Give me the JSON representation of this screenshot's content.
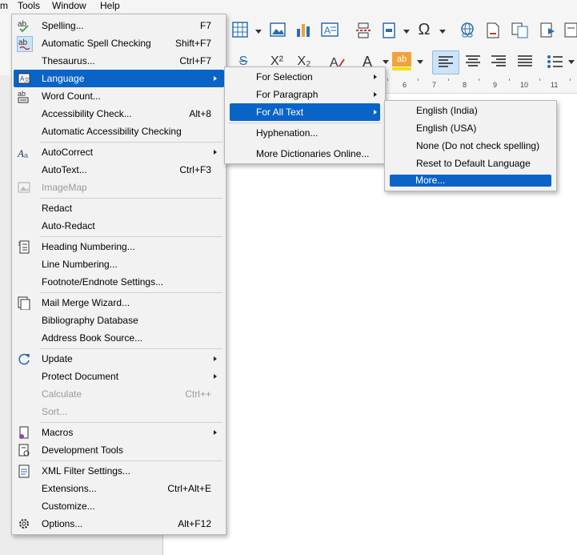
{
  "menubar": {
    "partial_item": "m",
    "tools": "Tools",
    "window": "Window",
    "help": "Help"
  },
  "ruler": {
    "ticks": [
      "6",
      "7",
      "8",
      "9",
      "10",
      "11"
    ]
  },
  "toolbar": {
    "superscript_glyph": "X²",
    "subscript_glyph": "X₂",
    "font_color_glyph": "A",
    "highlight_glyph": "ab",
    "special_char_glyph": "Ω",
    "strikethrough_glyph": "S"
  },
  "tools_menu": {
    "items": [
      {
        "label": "Spelling...",
        "shortcut": "F7"
      },
      {
        "label": "Automatic Spell Checking",
        "shortcut": "Shift+F7"
      },
      {
        "label": "Thesaurus...",
        "shortcut": "Ctrl+F7"
      },
      {
        "label": "Language"
      },
      {
        "label": "Word Count..."
      },
      {
        "label": "Accessibility Check...",
        "shortcut": "Alt+8"
      },
      {
        "label": "Automatic Accessibility Checking"
      },
      {
        "label": "AutoCorrect"
      },
      {
        "label": "AutoText...",
        "shortcut": "Ctrl+F3"
      },
      {
        "label": "ImageMap"
      },
      {
        "label": "Redact"
      },
      {
        "label": "Auto-Redact"
      },
      {
        "label": "Heading Numbering..."
      },
      {
        "label": "Line Numbering..."
      },
      {
        "label": "Footnote/Endnote Settings..."
      },
      {
        "label": "Mail Merge Wizard..."
      },
      {
        "label": "Bibliography Database"
      },
      {
        "label": "Address Book Source..."
      },
      {
        "label": "Update"
      },
      {
        "label": "Protect Document"
      },
      {
        "label": "Calculate",
        "shortcut": "Ctrl++"
      },
      {
        "label": "Sort..."
      },
      {
        "label": "Macros"
      },
      {
        "label": "Development Tools"
      },
      {
        "label": "XML Filter Settings..."
      },
      {
        "label": "Extensions...",
        "shortcut": "Ctrl+Alt+E"
      },
      {
        "label": "Customize..."
      },
      {
        "label": "Options...",
        "shortcut": "Alt+F12"
      }
    ]
  },
  "language_menu": {
    "items": [
      {
        "label": "For Selection"
      },
      {
        "label": "For Paragraph"
      },
      {
        "label": "For All Text"
      },
      {
        "label": "Hyphenation..."
      },
      {
        "label": "More Dictionaries Online..."
      }
    ]
  },
  "all_text_menu": {
    "items": [
      {
        "label": "English (India)"
      },
      {
        "label": "English (USA)"
      },
      {
        "label": "None (Do not check spelling)"
      },
      {
        "label": "Reset to Default Language"
      },
      {
        "label": "More..."
      }
    ]
  },
  "colors": {
    "highlight": "#0a64c8",
    "menu_bg": "#f2f2f2",
    "disabled_text": "#9a9a9a"
  }
}
